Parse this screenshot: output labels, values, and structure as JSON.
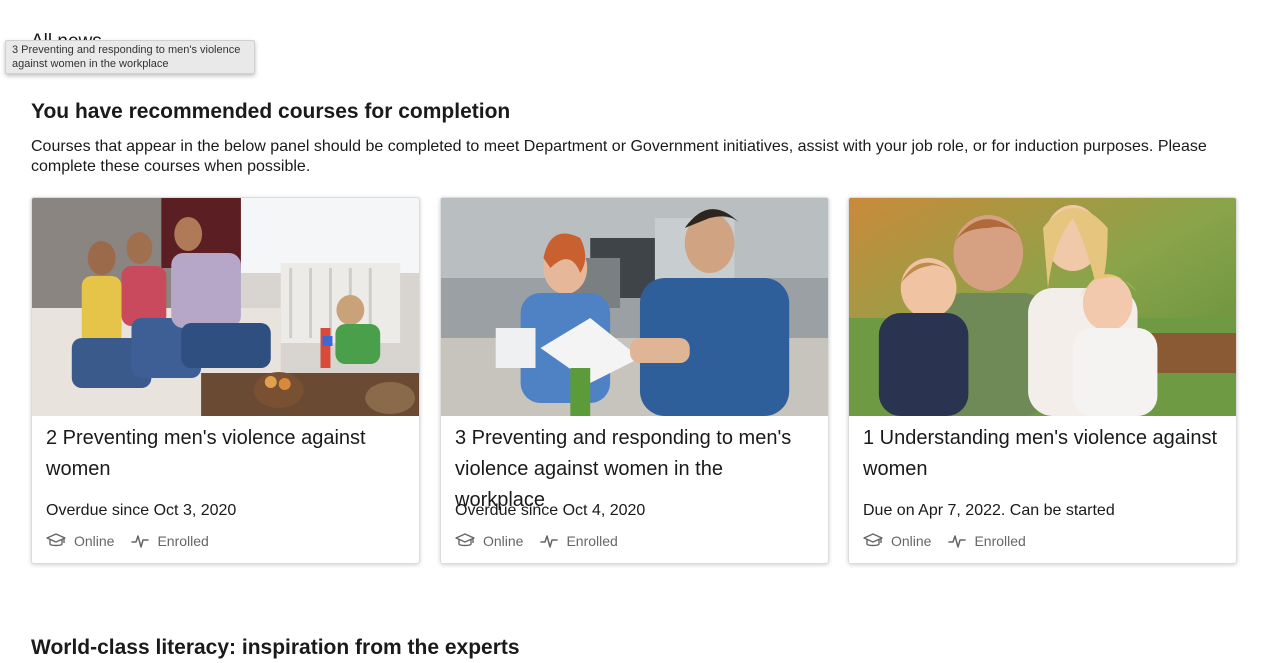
{
  "header": {
    "all_news": "All news"
  },
  "tooltip": {
    "text": "3 Preventing and responding to men's violence against women in the workplace"
  },
  "recommended": {
    "title": "You have recommended courses for completion",
    "description": "Courses that appear in the below panel should be completed to meet Department or Government initiatives, assist with your job role, or for induction purposes. Please complete these courses when possible."
  },
  "courses": [
    {
      "title": "2 Preventing men's violence against women",
      "status": "Overdue since Oct 3, 2020",
      "mode": "Online",
      "enrolment": "Enrolled",
      "mode_icon": "graduation-cap-icon",
      "enrolment_icon": "activity-pulse-icon"
    },
    {
      "title": "3 Preventing and responding to men's violence against women in the workplace",
      "status": "Overdue since Oct 4, 2020",
      "mode": "Online",
      "enrolment": "Enrolled",
      "mode_icon": "graduation-cap-icon",
      "enrolment_icon": "activity-pulse-icon"
    },
    {
      "title": "1 Understanding men's violence against women",
      "status": "Due on Apr 7, 2022. Can be started",
      "mode": "Online",
      "enrolment": "Enrolled",
      "mode_icon": "graduation-cap-icon",
      "enrolment_icon": "activity-pulse-icon"
    }
  ],
  "next_section": {
    "title": "World-class literacy: inspiration from the experts"
  },
  "colors": {
    "meta_text": "#666666",
    "icon": "#666666",
    "card_border": "#dcdcdc"
  }
}
